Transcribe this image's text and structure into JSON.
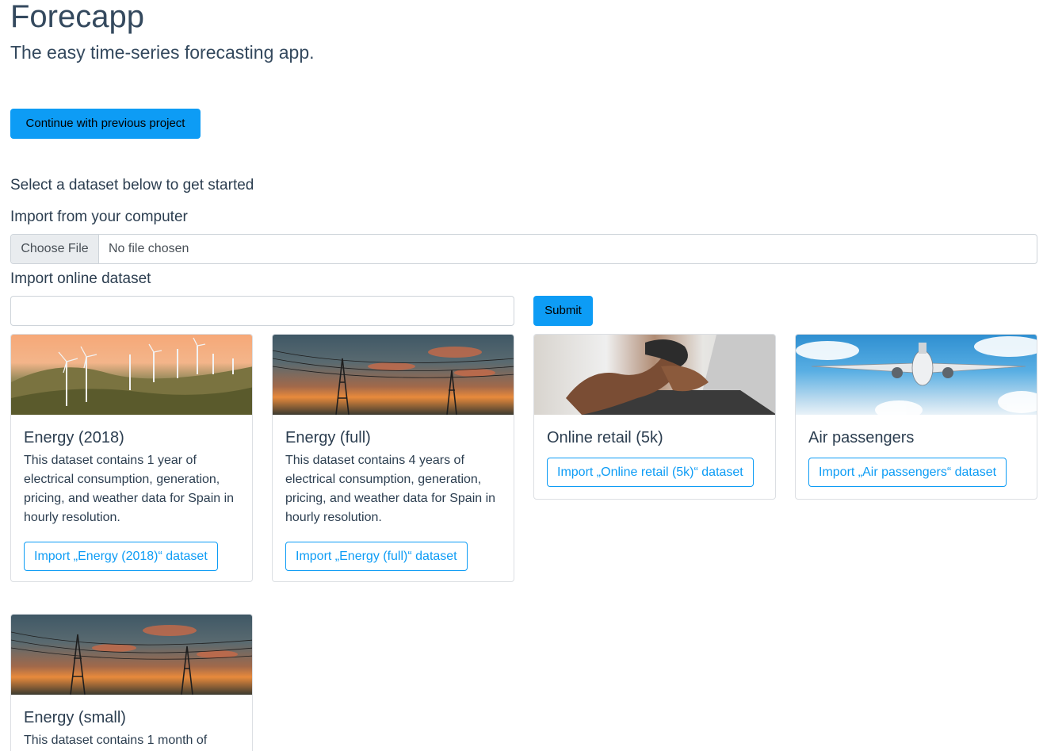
{
  "header": {
    "title": "Forecapp",
    "subtitle": "The easy time-series forecasting app."
  },
  "continue_button": "Continue with previous project",
  "select_label": "Select a dataset below to get started",
  "import_computer": {
    "label": "Import from your computer",
    "choose_label": "Choose File",
    "status": "No file chosen"
  },
  "import_online": {
    "label": "Import online dataset",
    "value": "",
    "submit_label": "Submit"
  },
  "cards": [
    {
      "title": "Energy (2018)",
      "text": "This dataset contains 1 year of electrical consumption, generation, pricing, and weather data for Spain in hourly resolution.",
      "button": "Import „Energy (2018)“ dataset",
      "image": "wind-turbines-image"
    },
    {
      "title": "Energy (full)",
      "text": "This dataset contains 4 years of electrical consumption, generation, pricing, and weather data for Spain in hourly resolution.",
      "button": "Import „Energy (full)“ dataset",
      "image": "power-lines-image"
    },
    {
      "title": "Online retail (5k)",
      "text": "",
      "button": "Import „Online retail (5k)“ dataset",
      "image": "laptop-typing-image"
    },
    {
      "title": "Air passengers",
      "text": "",
      "button": "Import „Air passengers“ dataset",
      "image": "airplane-image"
    },
    {
      "title": "Energy (small)",
      "text": "This dataset contains 1 month of",
      "button": "",
      "image": "power-lines-image"
    }
  ],
  "colors": {
    "primary": "#0d9cf5",
    "text": "#2c3e50",
    "border": "#dcdfe3"
  }
}
